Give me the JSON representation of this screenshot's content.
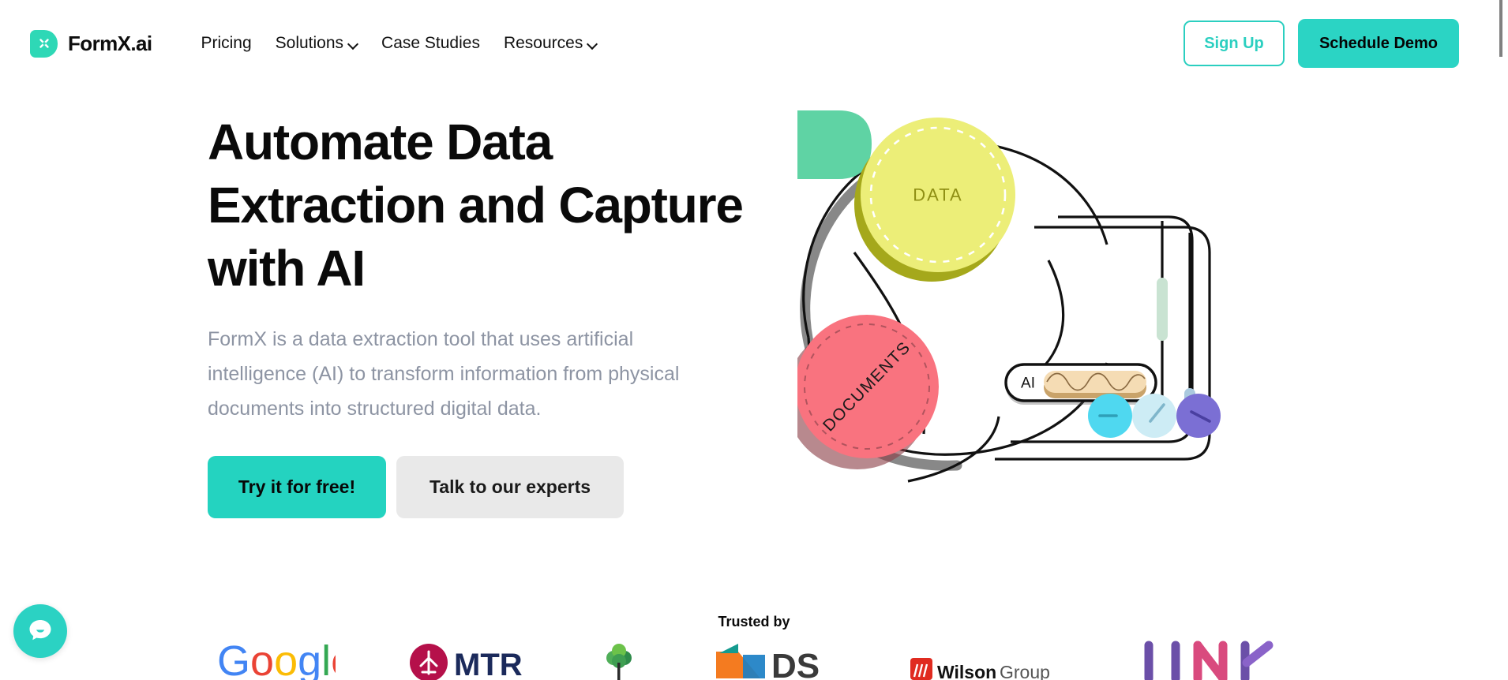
{
  "brand": {
    "name": "FormX.ai",
    "logo_icon": "formx-x-logo-icon",
    "accent": "#2ed8b6"
  },
  "nav": {
    "links": [
      {
        "label": "Pricing",
        "has_dropdown": false
      },
      {
        "label": "Solutions",
        "has_dropdown": true
      },
      {
        "label": "Case Studies",
        "has_dropdown": false
      },
      {
        "label": "Resources",
        "has_dropdown": true
      }
    ],
    "sign_up_label": "Sign Up",
    "schedule_demo_label": "Schedule Demo",
    "sign_up_color": "#2bcfc0",
    "schedule_demo_bg": "#2bd4c4"
  },
  "hero": {
    "title": "Automate Data Extraction and Capture with AI",
    "subtitle": "FormX is a data extraction tool that uses artificial intelligence (AI) to transform information from physical documents into structured digital data.",
    "primary_cta": "Try it for free!",
    "secondary_cta": "Talk to our experts",
    "primary_cta_bg": "#24d3c0",
    "secondary_cta_bg": "#e9e9e9"
  },
  "illustration": {
    "data_bubble_label": "DATA",
    "documents_bubble_label": "DOCUMENTS",
    "ai_chip_label": "AI",
    "colors": {
      "data_fill": "#ecee78",
      "data_shadow": "#a5a81b",
      "documents_fill": "#f9737f",
      "documents_shadow": "#8c4048",
      "green_block": "#5fd3a4",
      "ai_wave_fill": "#f5dcb4",
      "ai_wave_shadow": "#c9a36a",
      "dot_cyan": "#4fd8f0",
      "dot_pale": "#cdecf5",
      "dot_purple": "#7b6fd4",
      "pill_green": "#c9e3d2",
      "pill_blue": "#aac9de"
    }
  },
  "trusted": {
    "label": "Trusted by",
    "logos": [
      {
        "name": "Google",
        "text": "Google"
      },
      {
        "name": "MTR",
        "text": "MTR"
      },
      {
        "name": "tree-logo",
        "text": ""
      },
      {
        "name": "DS",
        "text": "DS"
      },
      {
        "name": "Wilson Group",
        "text": "Wilson Group"
      },
      {
        "name": "LINK",
        "text": "LINK"
      }
    ]
  },
  "chat": {
    "icon": "chat-bubble-icon",
    "bg": "#2bd2c3"
  },
  "scrollbar": {
    "thumb_color": "#808080"
  }
}
